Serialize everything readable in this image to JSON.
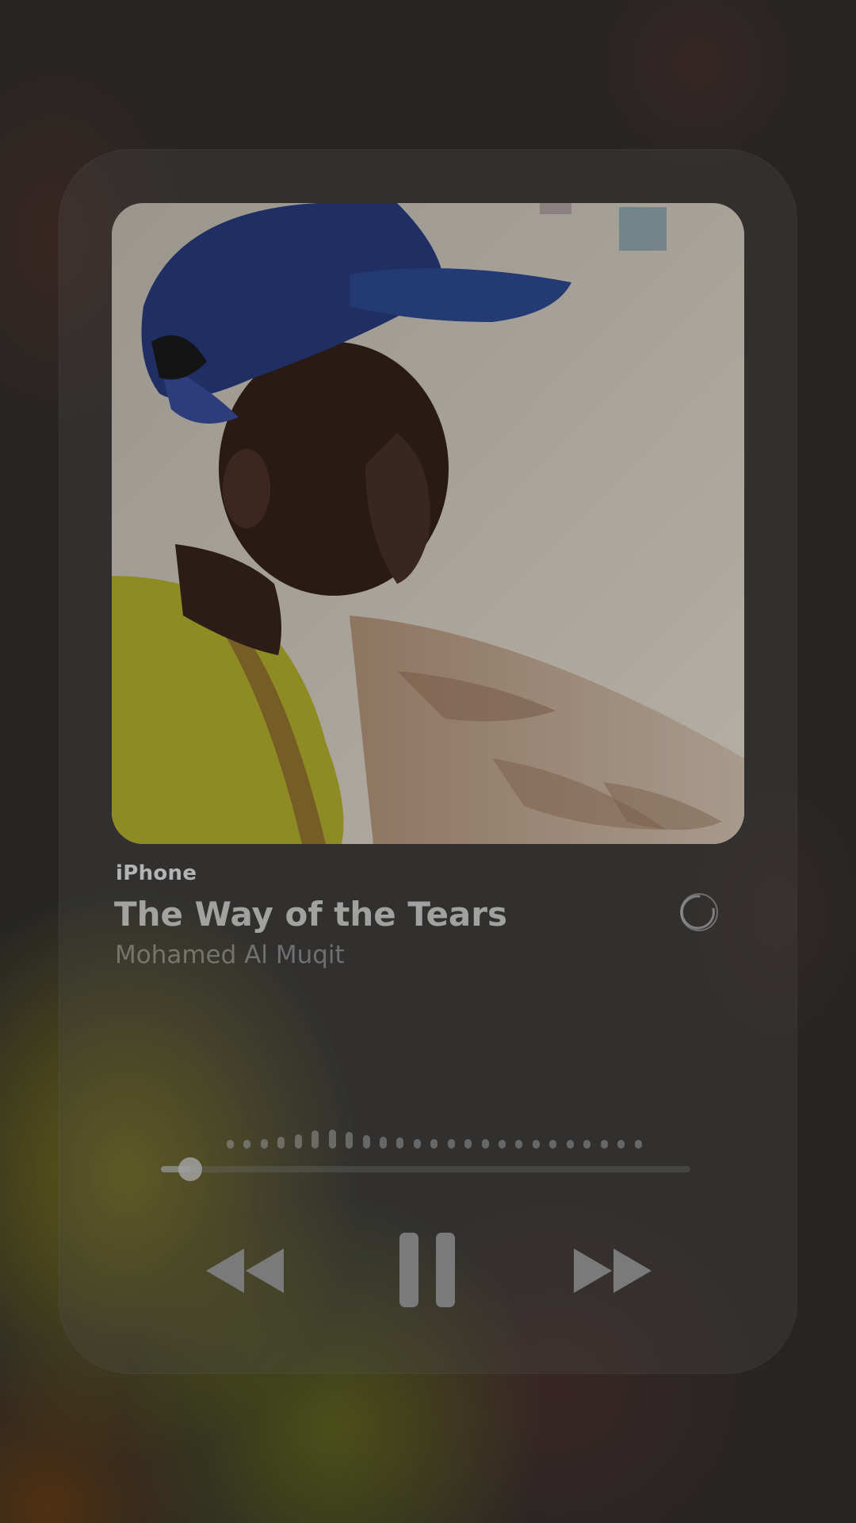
{
  "player": {
    "source_label": "iPhone",
    "track_title": "The Way of the Tears",
    "track_artist": "Mohamed Al Muqit",
    "progress": 0.055
  },
  "icons": {
    "status": "loading-spinner-icon",
    "rewind": "rewind-icon",
    "pause": "pause-icon",
    "forward": "fast-forward-icon"
  },
  "colors": {
    "background": "#262524",
    "card": "#3a3936",
    "controls": "#7a7a7a",
    "text_primary": "#e6e6e6"
  },
  "waveform": {
    "levels": [
      0.35,
      0.35,
      0.4,
      0.5,
      0.6,
      0.75,
      0.8,
      0.7,
      0.55,
      0.5,
      0.45,
      0.4,
      0.4,
      0.4,
      0.4,
      0.4,
      0.35,
      0.35,
      0.35,
      0.35,
      0.35,
      0.35,
      0.35,
      0.35,
      0.35
    ]
  }
}
